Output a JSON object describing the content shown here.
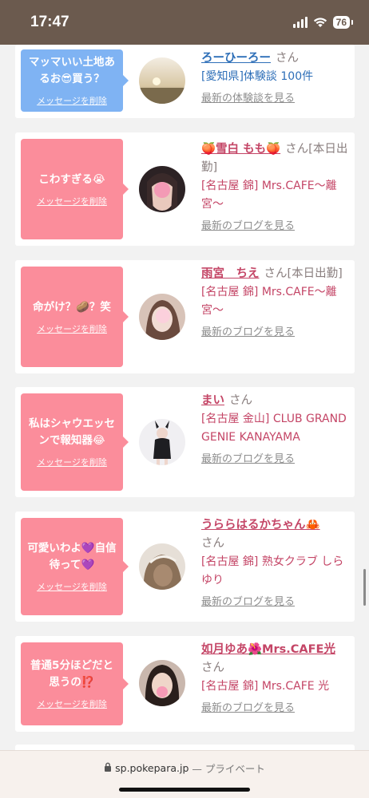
{
  "status_bar": {
    "time": "17:47",
    "battery": "76"
  },
  "delete_label": "メッセージを削除",
  "cards": [
    {
      "message": "マッマいい土地あるお😎買う？",
      "name": "ろーひーろー",
      "san": "さん",
      "shop": "[愛知県]体験談 100件",
      "more": "最新の体験談を見る",
      "style": "blue"
    },
    {
      "message": "こわすぎる😭",
      "name": "🍑雪白 もも🍑",
      "san": "さん[本日出勤]",
      "shop": "[名古屋 錦] Mrs.CAFE〜離宮〜",
      "more": "最新のブログを見る",
      "style": "pink"
    },
    {
      "message": "命がけ？🥔？笑",
      "name": "雨宮　ちえ",
      "san": "さん[本日出勤]",
      "shop": "[名古屋 錦] Mrs.CAFE〜離宮〜",
      "more": "最新のブログを見る",
      "style": "pink"
    },
    {
      "message": "私はシャウエッセンで報知器😂",
      "name": "まい",
      "san": "さん",
      "shop": "[名古屋 金山] CLUB GRAND GENIE KANAYAMA",
      "more": "最新のブログを見る",
      "style": "pink"
    },
    {
      "message": "可愛いわよ💜自信待って💜",
      "name": "うららはるかちゃん🦀",
      "san": "さん",
      "shop": "[名古屋 錦] 熟女クラブ しらゆり",
      "more": "最新のブログを見る",
      "style": "pink"
    },
    {
      "message": "普通5分ほどだと思うの⁉️",
      "name": "如月ゆあ🌺Mrs.CAFE光",
      "san": "さん",
      "shop": "[名古屋 錦] Mrs.CAFE 光",
      "more": "最新のブログを見る",
      "style": "pink"
    }
  ],
  "browser": {
    "url": "sp.pokepara.jp",
    "private": "— プライベート"
  }
}
